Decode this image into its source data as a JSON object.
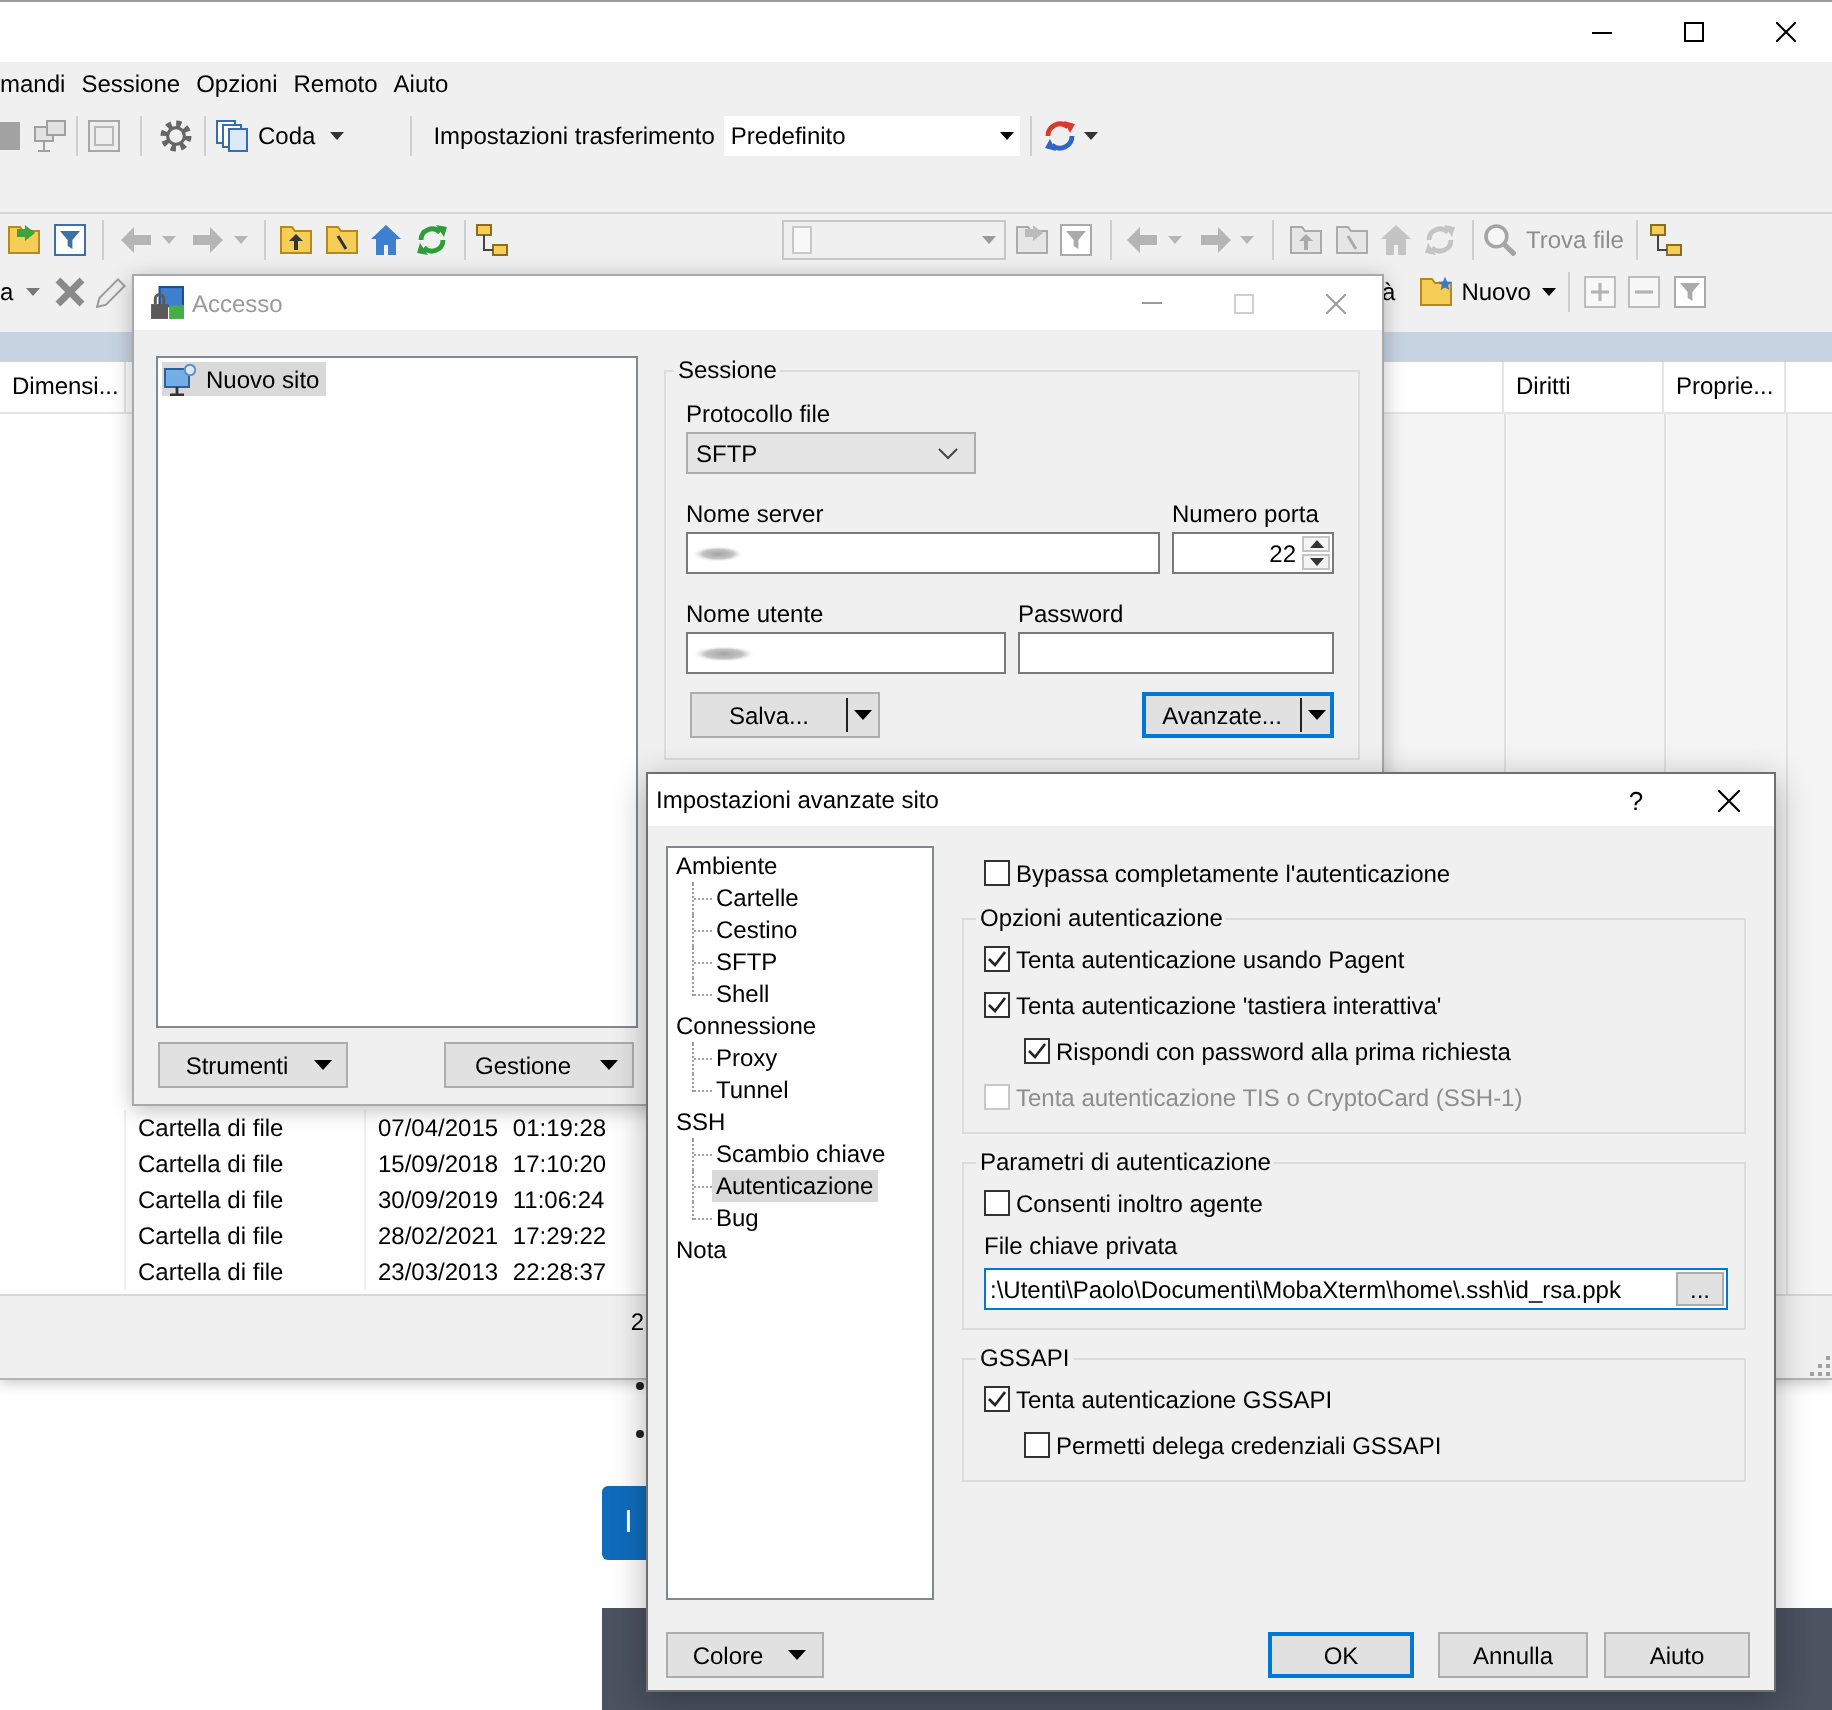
{
  "main_window": {
    "menu": [
      "mandi",
      "Sessione",
      "Opzioni",
      "Remoto",
      "Aiuto"
    ],
    "toolbar": {
      "queue": "Coda",
      "transfer_label": "Impostazioni trasferimento",
      "transfer_value": "Predefinito"
    },
    "left_panel": {
      "toolbar_label": "a",
      "columns": [
        "Dimensi..."
      ],
      "rows": [
        {
          "type": "Cartella di file",
          "modified": "07/04/2015 01:19:28"
        },
        {
          "type": "Cartella di file",
          "modified": "15/09/2018 17:10:20"
        },
        {
          "type": "Cartella di file",
          "modified": "30/09/2019 11:06:24"
        },
        {
          "type": "Cartella di file",
          "modified": "28/02/2021 17:29:22"
        },
        {
          "type": "Cartella di file",
          "modified": "23/03/2013 22:28:37"
        }
      ],
      "status": "2"
    },
    "right_panel": {
      "find_button": {
        "label": "Trova file",
        "disabled": true
      },
      "toolbar_label": "à",
      "new_button": {
        "label": "Nuovo",
        "disabled": false
      },
      "columns": [
        "Diritti",
        "Proprie..."
      ]
    }
  },
  "web_page": {
    "button": "I"
  },
  "login_dialog": {
    "title": "Accesso",
    "active": false,
    "sites": [
      {
        "label": "Nuovo sito",
        "selected": true
      }
    ],
    "buttons": [
      {
        "label": "Strumenti"
      },
      {
        "label": "Gestione"
      }
    ],
    "session": {
      "title": "Sessione",
      "protocol_label": "Protocollo file",
      "protocol": "SFTP",
      "host_label": "Nome server",
      "host_blurred": true,
      "port_label": "Numero porta",
      "port": "22",
      "user_label": "Nome utente",
      "user_blurred": true,
      "password_label": "Password",
      "buttons": [
        {
          "label": "Salva...",
          "default": false
        },
        {
          "label": "Avanzate...",
          "default": true
        }
      ]
    }
  },
  "advanced_dialog": {
    "title": "Impostazioni avanzate sito",
    "active": true,
    "help": "?",
    "tree": [
      {
        "label": "Ambiente",
        "selected": false,
        "children": [
          {
            "label": "Cartelle",
            "selected": false
          },
          {
            "label": "Cestino",
            "selected": false
          },
          {
            "label": "SFTP",
            "selected": false
          },
          {
            "label": "Shell",
            "selected": false
          }
        ]
      },
      {
        "label": "Connessione",
        "selected": false,
        "children": [
          {
            "label": "Proxy",
            "selected": false
          },
          {
            "label": "Tunnel",
            "selected": false
          }
        ]
      },
      {
        "label": "SSH",
        "selected": false,
        "children": [
          {
            "label": "Scambio chiave",
            "selected": false
          },
          {
            "label": "Autenticazione",
            "selected": true
          },
          {
            "label": "Bug",
            "selected": false
          }
        ]
      },
      {
        "label": "Nota",
        "selected": false
      }
    ],
    "options": [
      {
        "label": "Bypassa completamente l'autenticazione",
        "checked": false,
        "disabled": false
      }
    ],
    "groups": [
      {
        "title": "Opzioni autenticazione",
        "options": [
          {
            "label": "Tenta autenticazione usando Pagent",
            "checked": true,
            "disabled": false
          },
          {
            "label": "Tenta autenticazione 'tastiera interattiva'",
            "checked": true,
            "disabled": false,
            "children": [
              {
                "label": "Rispondi con password alla prima richiesta",
                "checked": true,
                "disabled": false
              }
            ]
          },
          {
            "label": "Tenta autenticazione TIS o CryptoCard (SSH-1)",
            "checked": false,
            "disabled": true
          }
        ]
      },
      {
        "title": "Parametri di autenticazione",
        "options": [
          {
            "label": "Consenti inoltro agente",
            "checked": false,
            "disabled": false
          }
        ],
        "key_file": {
          "label": "File chiave privata",
          "value": ":\\Utenti\\Paolo\\Documenti\\MobaXterm\\home\\.ssh\\id_rsa.ppk",
          "focused": true,
          "browse": "..."
        }
      },
      {
        "title": "GSSAPI",
        "options": [
          {
            "label": "Tenta autenticazione GSSAPI",
            "checked": true,
            "disabled": false,
            "children": [
              {
                "label": "Permetti delega credenziali GSSAPI",
                "checked": false,
                "disabled": false
              }
            ]
          }
        ]
      }
    ],
    "buttons": [
      {
        "label": "Colore",
        "kind": "dropdown",
        "default": false
      },
      {
        "label": "OK",
        "kind": "push",
        "default": true
      },
      {
        "label": "Annulla",
        "kind": "push",
        "default": false
      },
      {
        "label": "Aiuto",
        "kind": "push",
        "default": false
      }
    ]
  }
}
